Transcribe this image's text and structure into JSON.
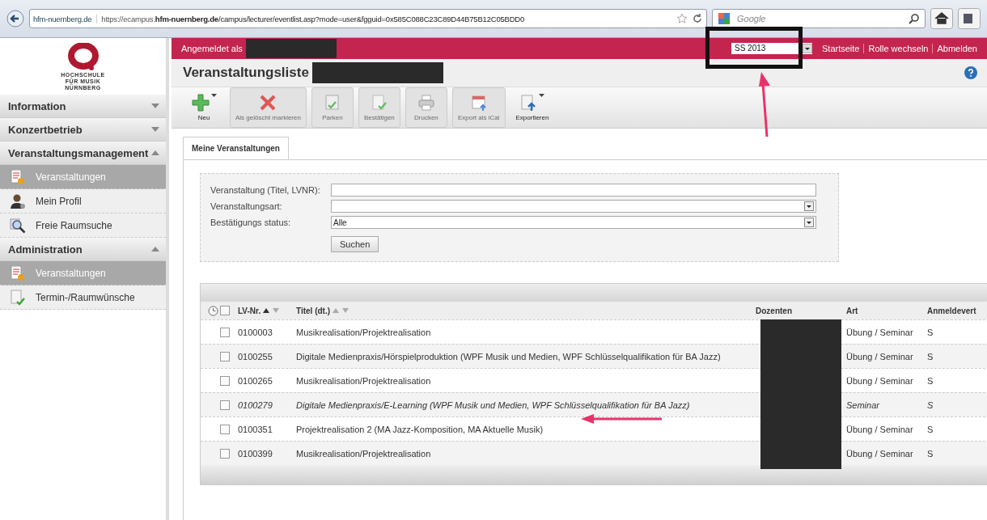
{
  "browser": {
    "site_identity": "hfm-nuernberg.de",
    "url_prefix": "https://ecampus.",
    "url_domain": "hfm-nuernberg.de",
    "url_rest": "/campus/lecturer/eventlist.asp?mode=user&fgguid=0x585C088C23C89D44B75B12C05BDD0",
    "search_placeholder": "Google"
  },
  "logo": {
    "lines": [
      "HOCHSCHULE",
      "FÜR MUSIK",
      "NÜRNBERG"
    ]
  },
  "sidebar": [
    {
      "label": "Information",
      "expanded": false
    },
    {
      "label": "Konzertbetrieb",
      "expanded": false
    },
    {
      "label": "Veranstaltungsmanagement",
      "expanded": true,
      "items": [
        {
          "label": "Veranstaltungen",
          "kind": "events",
          "selected": true
        },
        {
          "label": "Mein Profil",
          "kind": "profile",
          "selected": false
        },
        {
          "label": "Freie Raumsuche",
          "kind": "search",
          "selected": false
        }
      ]
    },
    {
      "label": "Administration",
      "expanded": true,
      "items": [
        {
          "label": "Veranstaltungen",
          "kind": "events",
          "selected": true
        },
        {
          "label": "Termin-/Raumwünsche",
          "kind": "request",
          "selected": false
        }
      ]
    }
  ],
  "header": {
    "logged_in_label": "Angemeldet als",
    "semester": "SS 2013",
    "links": [
      "Startseite",
      "Rolle wechseln",
      "Abmelden"
    ]
  },
  "page_title": "Veranstaltungsliste",
  "toolbar": [
    {
      "label": "Neu",
      "kind": "new",
      "disabled": false,
      "dropdown": true
    },
    {
      "label": "Als gelöscht markieren",
      "kind": "delete",
      "disabled": true,
      "dropdown": false
    },
    {
      "label": "Parken",
      "kind": "park",
      "disabled": true,
      "dropdown": false
    },
    {
      "label": "Bestätigen",
      "kind": "confirm",
      "disabled": true,
      "dropdown": false
    },
    {
      "label": "Drucken",
      "kind": "print",
      "disabled": true,
      "dropdown": false
    },
    {
      "label": "Export als iCal",
      "kind": "ical",
      "disabled": true,
      "dropdown": false
    },
    {
      "label": "Exportieren",
      "kind": "export",
      "disabled": false,
      "dropdown": true
    }
  ],
  "tabs": [
    {
      "label": "Meine Veranstaltungen",
      "selected": true
    }
  ],
  "filters": [
    {
      "label": "Veranstaltung (Titel, LVNR):",
      "kind": "text"
    },
    {
      "label": "Veranstaltungsart:",
      "kind": "select"
    },
    {
      "label": "Bestätigungs status:",
      "kind": "select",
      "value": "Alle"
    }
  ],
  "search_button": "Suchen",
  "table": {
    "header_checked": false,
    "columns": [
      "LV-Nr.",
      "Titel (dt.)",
      "Dozenten",
      "Art",
      "Anmeldevert"
    ],
    "rows": [
      {
        "nr": "0100003",
        "title": "Musikrealisation/Projektrealisation",
        "art": "Übung / Seminar",
        "column_5": "S",
        "italic": false,
        "checked": false
      },
      {
        "nr": "0100255",
        "title": "Digitale Medienpraxis/Hörspielproduktion (WPF Musik und Medien, WPF Schlüsselqualifikation für BA Jazz)",
        "art": "Übung / Seminar",
        "column_5": "S",
        "italic": false,
        "checked": false
      },
      {
        "nr": "0100265",
        "title": "Musikrealisation/Projektrealisation",
        "art": "Übung / Seminar",
        "column_5": "S",
        "italic": false,
        "checked": false
      },
      {
        "nr": "0100279",
        "title": "Digitale Medienpraxis/E-Learning (WPF Musik und Medien, WPF Schlüsselqualifikation für BA Jazz)",
        "art": "Seminar",
        "column_5": "S",
        "italic": true,
        "checked": false
      },
      {
        "nr": "0100351",
        "title": "Projektrealisation 2 (MA Jazz-Komposition, MA Aktuelle Musik)",
        "art": "Übung / Seminar",
        "column_5": "S",
        "italic": false,
        "checked": false
      },
      {
        "nr": "0100399",
        "title": "Musikrealisation/Projektrealisation",
        "art": "Übung / Seminar",
        "column_5": "S",
        "italic": false,
        "checked": false
      }
    ]
  }
}
